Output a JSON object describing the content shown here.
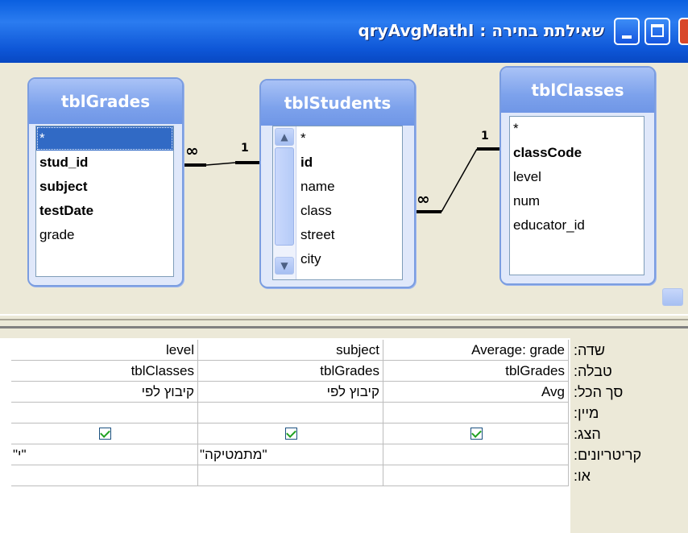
{
  "window": {
    "title": "qryAvgMathI : שאילתת בחירה",
    "buttons": [
      "minimize",
      "maximize",
      "close"
    ]
  },
  "tables": [
    {
      "name": "tblGrades",
      "fields": [
        {
          "label": "*",
          "bold": false,
          "selected": true
        },
        {
          "label": "stud_id",
          "bold": true
        },
        {
          "label": "subject",
          "bold": true
        },
        {
          "label": "testDate",
          "bold": true
        },
        {
          "label": "grade",
          "bold": false
        }
      ]
    },
    {
      "name": "tblStudents",
      "fields": [
        {
          "label": "*",
          "bold": false
        },
        {
          "label": "id",
          "bold": true
        },
        {
          "label": "name",
          "bold": false
        },
        {
          "label": "class",
          "bold": false
        },
        {
          "label": "street",
          "bold": false
        },
        {
          "label": "city",
          "bold": false
        }
      ]
    },
    {
      "name": "tblClasses",
      "fields": [
        {
          "label": "*",
          "bold": false
        },
        {
          "label": "classCode",
          "bold": true
        },
        {
          "label": "level",
          "bold": false
        },
        {
          "label": "num",
          "bold": false
        },
        {
          "label": "educator_id",
          "bold": false
        }
      ]
    }
  ],
  "relationships": [
    {
      "from_side": "∞",
      "to_side": "1"
    },
    {
      "from_side": "∞",
      "to_side": "1"
    }
  ],
  "grid": {
    "row_labels": [
      "שדה:",
      "טבלה:",
      "סך הכל:",
      "מיין:",
      "הצג:",
      "קריטריונים:",
      "או:"
    ],
    "columns": [
      {
        "field": "Average: grade",
        "table": "tblGrades",
        "total": "Avg",
        "sort": "",
        "show": true,
        "criteria": ""
      },
      {
        "field": "subject",
        "table": "tblGrades",
        "total": "קיבוץ לפי",
        "sort": "",
        "show": true,
        "criteria": "\"מתמטיקה\""
      },
      {
        "field": "level",
        "table": "tblClasses",
        "total": "קיבוץ לפי",
        "sort": "",
        "show": true,
        "criteria": "\"י\""
      }
    ]
  }
}
